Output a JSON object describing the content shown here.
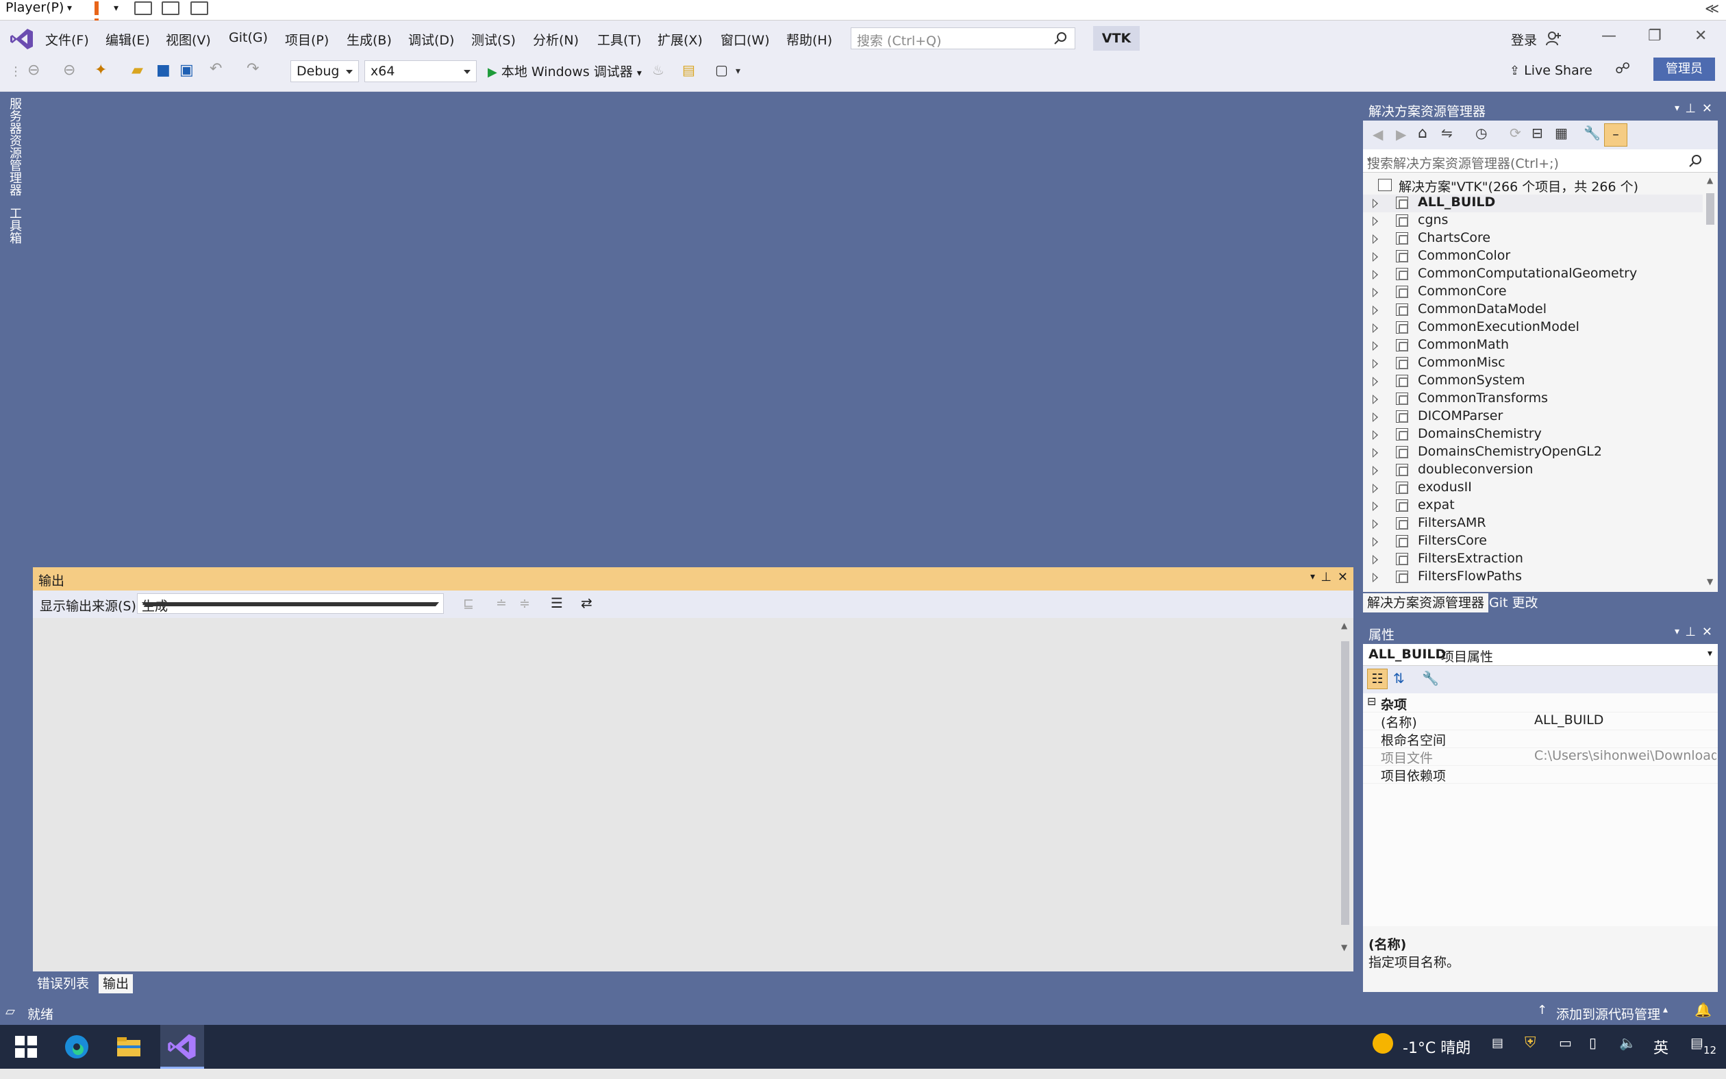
{
  "player": {
    "label": "Player(P)"
  },
  "menubar": {
    "items": [
      "文件(F)",
      "编辑(E)",
      "视图(V)",
      "Git(G)",
      "项目(P)",
      "生成(B)",
      "调试(D)",
      "测试(S)",
      "分析(N)",
      "工具(T)",
      "扩展(X)",
      "窗口(W)",
      "帮助(H)"
    ],
    "search_placeholder": "搜索 (Ctrl+Q)",
    "solution_name": "VTK",
    "login": "登录"
  },
  "toolbar": {
    "config": "Debug",
    "platform": "x64",
    "run_label": "本地 Windows 调试器",
    "live_share": "Live Share",
    "admin": "管理员"
  },
  "left_rail": {
    "server_explorer": "服务器资源管理器",
    "toolbox": "工具箱"
  },
  "output": {
    "title": "输出",
    "source_label": "显示输出来源(S):",
    "source_value": "生成",
    "tabs": [
      "错误列表",
      "输出"
    ]
  },
  "solution_explorer": {
    "title": "解决方案资源管理器",
    "search_placeholder": "搜索解决方案资源管理器(Ctrl+;)",
    "root": "解决方案\"VTK\"(266 个项目，共 266 个)",
    "projects": [
      "ALL_BUILD",
      "cgns",
      "ChartsCore",
      "CommonColor",
      "CommonComputationalGeometry",
      "CommonCore",
      "CommonDataModel",
      "CommonExecutionModel",
      "CommonMath",
      "CommonMisc",
      "CommonSystem",
      "CommonTransforms",
      "DICOMParser",
      "DomainsChemistry",
      "DomainsChemistryOpenGL2",
      "doubleconversion",
      "exodusII",
      "expat",
      "FiltersAMR",
      "FiltersCore",
      "FiltersExtraction",
      "FiltersFlowPaths"
    ],
    "tabs": [
      "解决方案资源管理器",
      "Git 更改"
    ]
  },
  "properties": {
    "title": "属性",
    "object_name": "ALL_BUILD",
    "object_type": "项目属性",
    "category": "杂项",
    "rows": [
      {
        "name": "(名称)",
        "value": "ALL_BUILD"
      },
      {
        "name": "根命名空间",
        "value": ""
      },
      {
        "name": "项目文件",
        "value": "C:\\Users\\sihonwei\\Downloads\\V"
      },
      {
        "name": "项目依赖项",
        "value": ""
      }
    ],
    "desc_title": "(名称)",
    "desc_text": "指定项目名称。"
  },
  "statusbar": {
    "ready": "就绪",
    "source_control": "添加到源代码管理"
  },
  "taskbar": {
    "weather": "-1°C 晴朗",
    "ime": "英",
    "notifications": "12"
  },
  "colors": {
    "accent": "#5a6c99",
    "output_header": "#f5cc84",
    "admin_button": "#4d6bb0"
  }
}
